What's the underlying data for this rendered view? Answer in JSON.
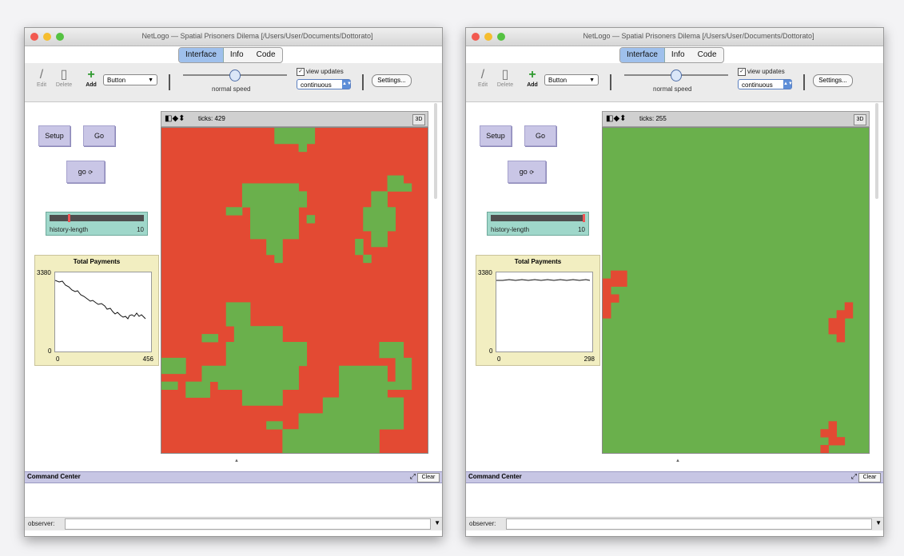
{
  "colors": {
    "red": "#e34a33",
    "green": "#6ab04c",
    "button": "#c9c6e6",
    "chooser": "#9fd7ca",
    "plot": "#f2eec1"
  },
  "windows": [
    {
      "title": "NetLogo — Spatial Prisoners Dilema [/Users/User/Documents/Dottorato]",
      "tabs": [
        "Interface",
        "Info",
        "Code"
      ],
      "selected_tab": "Interface",
      "toolbar": {
        "edit": "Edit",
        "delete": "Delete",
        "add": "Add",
        "widget": "Button",
        "speed_label": "normal speed",
        "view_updates": "view updates",
        "update_mode": "continuous",
        "settings": "Settings..."
      },
      "buttons": {
        "setup": "Setup",
        "go": "Go",
        "go_once": "go"
      },
      "chooser": {
        "label": "history-length",
        "value": "10",
        "fraction": 0.2
      },
      "plot": {
        "title": "Total Payments",
        "y_max": "3380",
        "y_min": "0",
        "x_min": "0",
        "x_max": "456"
      },
      "view": {
        "ticks": "ticks: 429",
        "btn3d": "3D"
      },
      "command": {
        "title": "Command Center",
        "clear": "Clear",
        "observer": "observer:"
      }
    },
    {
      "title": "NetLogo — Spatial Prisoners Dilema [/Users/User/Documents/Dottorato]",
      "tabs": [
        "Interface",
        "Info",
        "Code"
      ],
      "selected_tab": "Interface",
      "toolbar": {
        "edit": "Edit",
        "delete": "Delete",
        "add": "Add",
        "widget": "Button",
        "speed_label": "normal speed",
        "view_updates": "view updates",
        "update_mode": "continuous",
        "settings": "Settings..."
      },
      "buttons": {
        "setup": "Setup",
        "go": "Go",
        "go_once": "go"
      },
      "chooser": {
        "label": "history-length",
        "value": "10",
        "fraction": 1.0
      },
      "plot": {
        "title": "Total Payments",
        "y_max": "3380",
        "y_min": "0",
        "x_min": "0",
        "x_max": "298"
      },
      "view": {
        "ticks": "ticks: 255",
        "btn3d": "3D"
      },
      "command": {
        "title": "Command Center",
        "clear": "Clear",
        "observer": "observer:"
      }
    }
  ]
}
